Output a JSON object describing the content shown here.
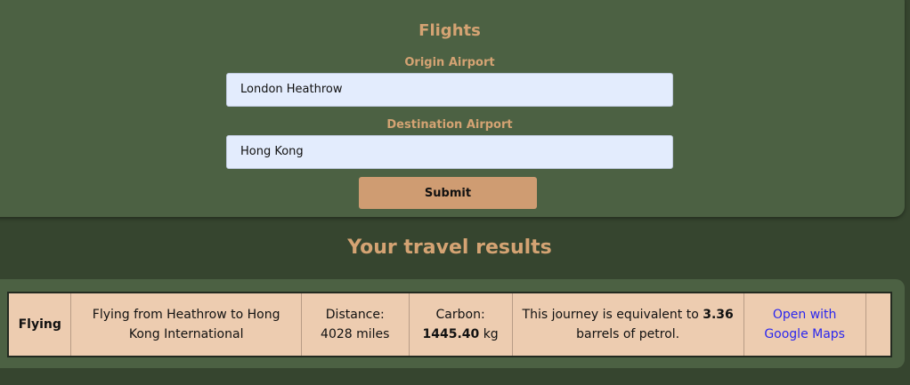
{
  "flights_form": {
    "title": "Flights",
    "origin_label": "Origin Airport",
    "origin_value": "London Heathrow",
    "destination_label": "Destination Airport",
    "destination_value": "Hong Kong",
    "submit_label": "Submit"
  },
  "results": {
    "heading": "Your travel results",
    "row": {
      "mode": "Flying",
      "route": "Flying from Heathrow to Hong Kong International",
      "distance_label": "Distance:",
      "distance_value": "4028 miles",
      "carbon_label": "Carbon:",
      "carbon_value": "1445.40",
      "carbon_unit": "kg",
      "equiv_prefix": "This journey is equivalent to",
      "equiv_value": "3.36",
      "equiv_suffix": "barrels of petrol.",
      "maps_link": "Open with Google Maps"
    }
  },
  "colors": {
    "background": "#36452f",
    "panel": "#4c6143",
    "accent": "#d4a373",
    "button": "#cf9c72",
    "input": "#e3ecfd",
    "result_row": "#edccb0",
    "link": "#2b27ef"
  }
}
